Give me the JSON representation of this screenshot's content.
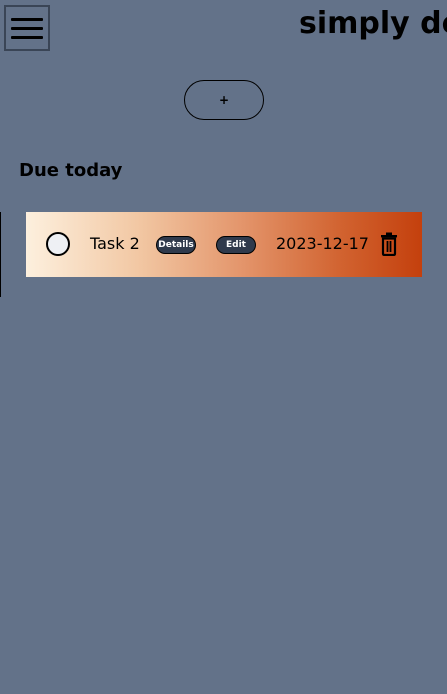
{
  "header": {
    "title": "simply do",
    "menu_icon": "hamburger-menu-icon"
  },
  "toolbar": {
    "add_label": "+"
  },
  "sections": [
    {
      "heading": "Due today",
      "tasks": [
        {
          "name": "Task 2",
          "details_label": "Details",
          "edit_label": "Edit",
          "date": "2023-12-17",
          "completed": false,
          "check_icon": "circle-checkbox-icon",
          "delete_icon": "trash-icon"
        }
      ]
    }
  ],
  "colors": {
    "background": "#637289",
    "card_gradient_start": "#fdf0de",
    "card_gradient_end": "#c4400d",
    "pill_button": "#2f3a4c"
  }
}
